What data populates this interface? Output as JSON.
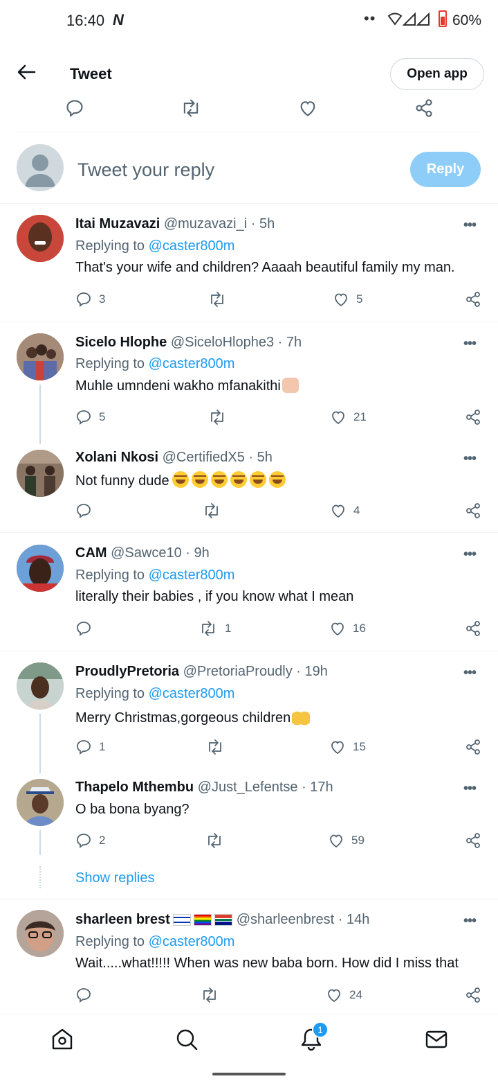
{
  "status_bar": {
    "time": "16:40",
    "notif_icon": "N",
    "battery": "60%"
  },
  "header": {
    "title": "Tweet",
    "open_app": "Open app"
  },
  "composer": {
    "placeholder": "Tweet your reply",
    "reply_button": "Reply"
  },
  "tweets": [
    {
      "name": "Itai Muzavazi",
      "handle": "@muzavazi_i · 5h",
      "replying_prefix": "Replying to",
      "replying_to": "@caster800m",
      "text": "That's your wife and children? Aaaah beautiful family my man.",
      "replies": "3",
      "retweets": "",
      "likes": "5",
      "avatar_color": "#7a3b2a"
    },
    {
      "name": "Sicelo Hlophe",
      "handle": "@SiceloHlophe3 · 7h",
      "replying_prefix": "Replying to",
      "replying_to": "@caster800m",
      "text": "Muhle umndeni wakho mfanakithi",
      "replies": "5",
      "retweets": "",
      "likes": "21",
      "avatar_color": "#8b6a55"
    },
    {
      "name": "Xolani Nkosi",
      "handle": "@CertifiedX5 · 5h",
      "text": "Not funny dude",
      "replies": "",
      "retweets": "",
      "likes": "4",
      "avatar_color": "#5a4b3f"
    },
    {
      "name": "CAM",
      "handle": "@Sawce10 · 9h",
      "replying_prefix": "Replying to",
      "replying_to": "@caster800m",
      "text": "literally their babies , if you know what I mean",
      "replies": "",
      "retweets": "1",
      "likes": "16",
      "avatar_color": "#3b2a22"
    },
    {
      "name": "ProudlyPretoria",
      "handle": "@PretoriaProudly · 19h",
      "replying_prefix": "Replying to",
      "replying_to": "@caster800m",
      "text": "Merry Christmas,gorgeous children",
      "replies": "1",
      "retweets": "",
      "likes": "15",
      "avatar_color": "#8fa5b2"
    },
    {
      "name": "Thapelo Mthembu",
      "handle": "@Just_Lefentse · 17h",
      "text": "O ba bona byang?",
      "replies": "2",
      "retweets": "",
      "likes": "59",
      "avatar_color": "#6b7f9a"
    },
    {
      "name": "sharleen brest",
      "handle": "@sharleenbrest · 14h",
      "replying_prefix": "Replying to",
      "replying_to": "@caster800m",
      "text": "Wait.....what!!!!! When was new baba born. How did I miss that",
      "replies": "",
      "retweets": "",
      "likes": "24",
      "avatar_color": "#a07a63"
    }
  ],
  "show_replies": "Show replies",
  "bottom_nav": {
    "notification_badge": "1"
  },
  "colors": {
    "accent": "#1d9bf0",
    "reply_button_disabled": "#8ecdf8",
    "secondary_text": "#536471"
  }
}
